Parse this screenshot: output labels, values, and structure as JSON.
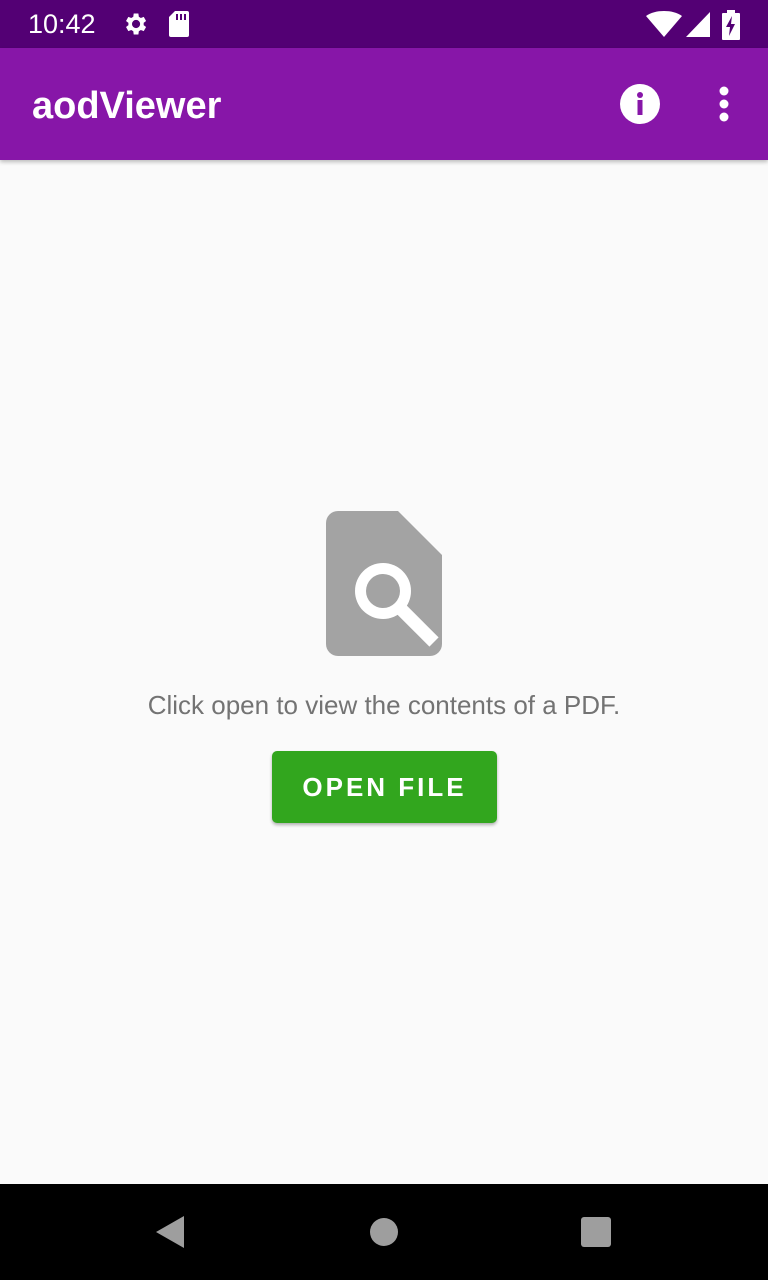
{
  "status_bar": {
    "time": "10:42",
    "icons": [
      "gear-icon",
      "sd-card-icon",
      "wifi-icon",
      "signal-icon",
      "battery-charging-icon"
    ],
    "background_color": "#530074"
  },
  "app_bar": {
    "title": "aodViewer",
    "actions": [
      "info-icon",
      "more-vert-icon"
    ],
    "background_color": "#8716a8"
  },
  "main": {
    "illustration_icon": "find-in-page-icon",
    "message": "Click open to view the contents of a PDF.",
    "open_button_label": "OPEN FILE",
    "button_color": "#32a61e"
  },
  "nav_bar": {
    "buttons": [
      "back-icon",
      "home-icon",
      "recents-icon"
    ]
  }
}
